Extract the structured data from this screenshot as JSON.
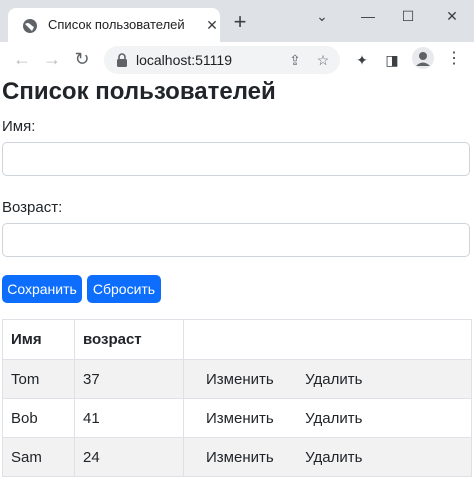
{
  "browser": {
    "tab_title": "Список пользователей",
    "url": "localhost:51119",
    "new_tab_symbol": "+",
    "tab_close_symbol": "✕",
    "minimize_symbol": "—",
    "maximize_symbol": "☐",
    "close_symbol": "✕",
    "back_symbol": "←",
    "forward_symbol": "→",
    "reload_symbol": "↻",
    "share_symbol": "⇪",
    "star_symbol": "☆",
    "extensions_symbol": "✦",
    "sidepanel_symbol": "◨",
    "menu_symbol": "⋮"
  },
  "page": {
    "title": "Список пользователей",
    "name_label": "Имя:",
    "name_value": "",
    "age_label": "Возраст:",
    "age_value": "",
    "save_label": "Сохранить",
    "reset_label": "Сбросить"
  },
  "table": {
    "headers": [
      "Имя",
      "возраст",
      ""
    ],
    "rows": [
      {
        "name": "Tom",
        "age": "37",
        "edit": "Изменить",
        "delete": "Удалить"
      },
      {
        "name": "Bob",
        "age": "41",
        "edit": "Изменить",
        "delete": "Удалить"
      },
      {
        "name": "Sam",
        "age": "24",
        "edit": "Изменить",
        "delete": "Удалить"
      }
    ]
  },
  "colors": {
    "primary_button": "#0d6efd",
    "stripe": "#f2f2f2",
    "chrome_bar": "#dee1e6"
  }
}
